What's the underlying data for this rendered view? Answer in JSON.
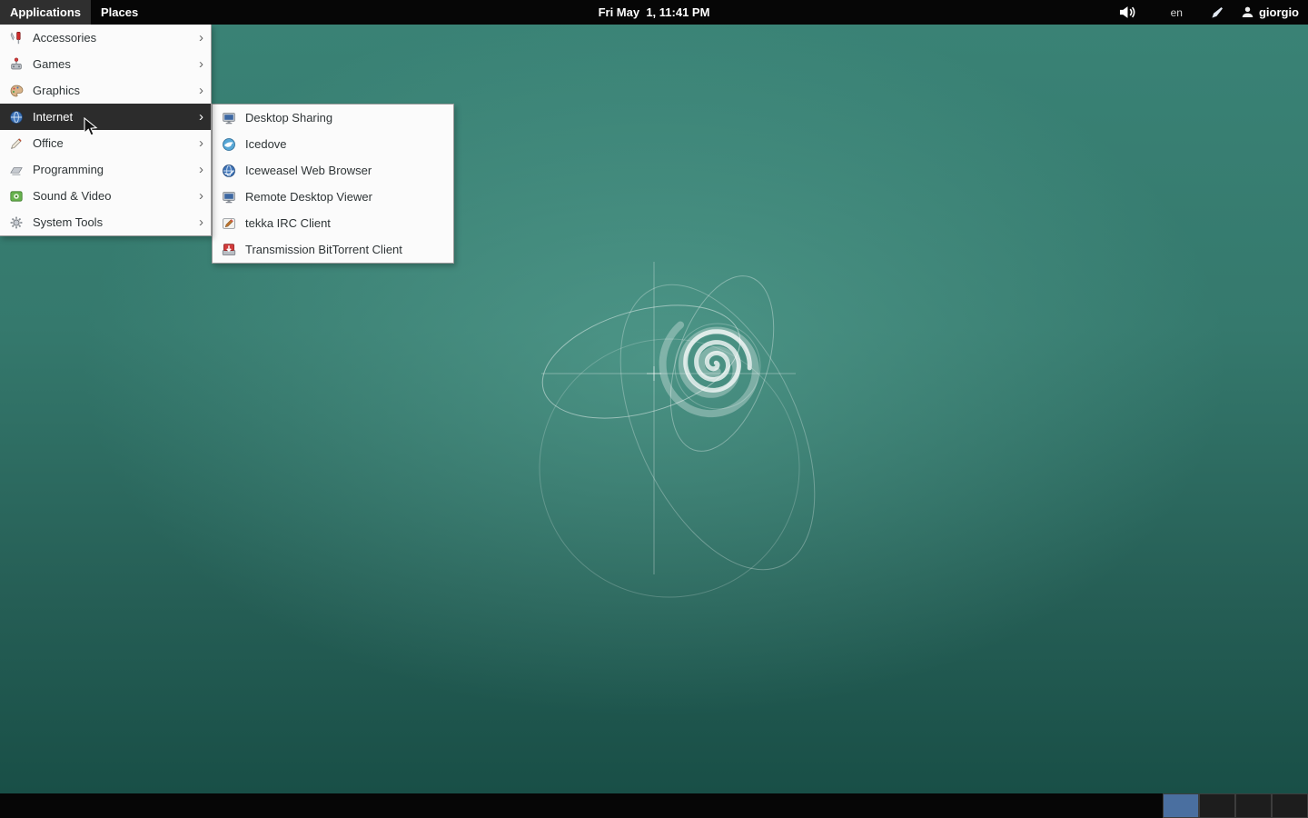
{
  "top_bar": {
    "applications_label": "Applications",
    "places_label": "Places",
    "clock": "Fri May  1, 11:41 PM",
    "keyboard_layout": "en",
    "username": "giorgio"
  },
  "applications_menu": {
    "submenu_arrow_glyph": "›",
    "items": [
      {
        "label": "Accessories",
        "icon": "accessories-icon",
        "active": false
      },
      {
        "label": "Games",
        "icon": "games-icon",
        "active": false
      },
      {
        "label": "Graphics",
        "icon": "graphics-icon",
        "active": false
      },
      {
        "label": "Internet",
        "icon": "internet-icon",
        "active": true
      },
      {
        "label": "Office",
        "icon": "office-icon",
        "active": false
      },
      {
        "label": "Programming",
        "icon": "programming-icon",
        "active": false
      },
      {
        "label": "Sound & Video",
        "icon": "sound-video-icon",
        "active": false
      },
      {
        "label": "System Tools",
        "icon": "system-tools-icon",
        "active": false
      }
    ]
  },
  "internet_submenu": {
    "items": [
      {
        "label": "Desktop Sharing",
        "icon": "desktop-sharing-icon"
      },
      {
        "label": "Icedove",
        "icon": "icedove-icon"
      },
      {
        "label": "Iceweasel Web Browser",
        "icon": "iceweasel-icon"
      },
      {
        "label": "Remote Desktop Viewer",
        "icon": "remote-desktop-icon"
      },
      {
        "label": "tekka IRC Client",
        "icon": "irc-icon"
      },
      {
        "label": "Transmission BitTorrent Client",
        "icon": "transmission-icon"
      }
    ]
  },
  "workspace_switcher": {
    "count": 4,
    "active_index": 0,
    "active_color": "#4a6fa0",
    "inactive_color": "#1d1d1d"
  },
  "colors": {
    "desktop_teal": "#3a8376",
    "panel_black": "#060606",
    "menu_highlight": "#2c2c2c"
  }
}
